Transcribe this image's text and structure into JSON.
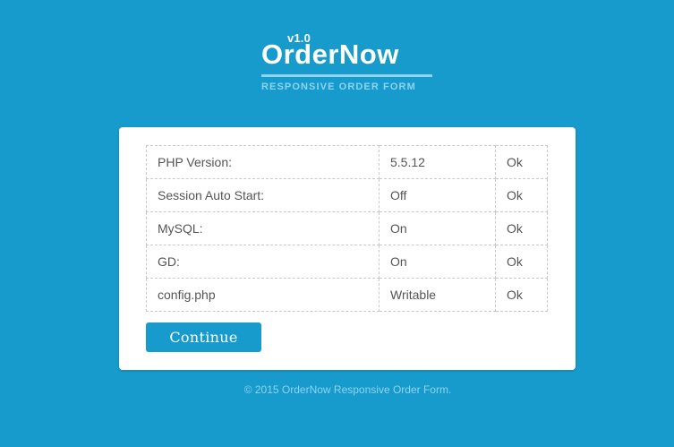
{
  "logo": {
    "version": "v1.0",
    "name": "OrderNow",
    "tagline": "RESPONSIVE ORDER FORM"
  },
  "checks": {
    "rows": [
      {
        "label": "PHP Version:",
        "value": "5.5.12",
        "status": "Ok"
      },
      {
        "label": "Session Auto Start:",
        "value": "Off",
        "status": "Ok"
      },
      {
        "label": "MySQL:",
        "value": "On",
        "status": "Ok"
      },
      {
        "label": "GD:",
        "value": "On",
        "status": "Ok"
      },
      {
        "label": "config.php",
        "value": "Writable",
        "status": "Ok"
      }
    ]
  },
  "actions": {
    "continue_label": "Continue"
  },
  "footer": {
    "text": "© 2015 OrderNow Responsive Order Form."
  },
  "colors": {
    "background": "#179bcd",
    "accent_light": "#8fd3ee",
    "card": "#ffffff",
    "text": "#555555"
  }
}
